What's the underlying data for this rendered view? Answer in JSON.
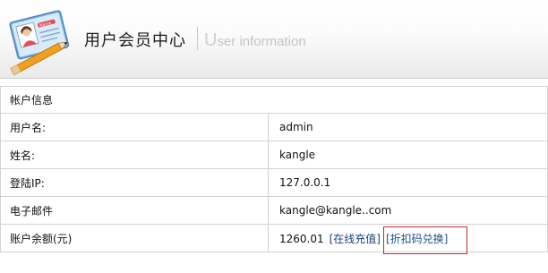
{
  "header": {
    "title_cn": "用户会员中心",
    "title_en_first": "U",
    "title_en_rest": "ser information",
    "logo_icon": "member-card-icon"
  },
  "table": {
    "caption": "帐户信息",
    "rows": [
      {
        "label": "用户名:",
        "value": "admin"
      },
      {
        "label": "姓名:",
        "value": "kangle"
      },
      {
        "label": "登陆IP:",
        "value": "127.0.0.1"
      },
      {
        "label": "电子邮件",
        "value": "kangle@kangle..com"
      },
      {
        "label": "账户余额(元)",
        "value": "1260.01"
      }
    ],
    "balance_links": {
      "recharge": "[在线充值]",
      "coupon": "[折扣码兑换]"
    }
  },
  "colors": {
    "highlight_border": "#cc2a2a",
    "link": "#1a3f7a"
  }
}
